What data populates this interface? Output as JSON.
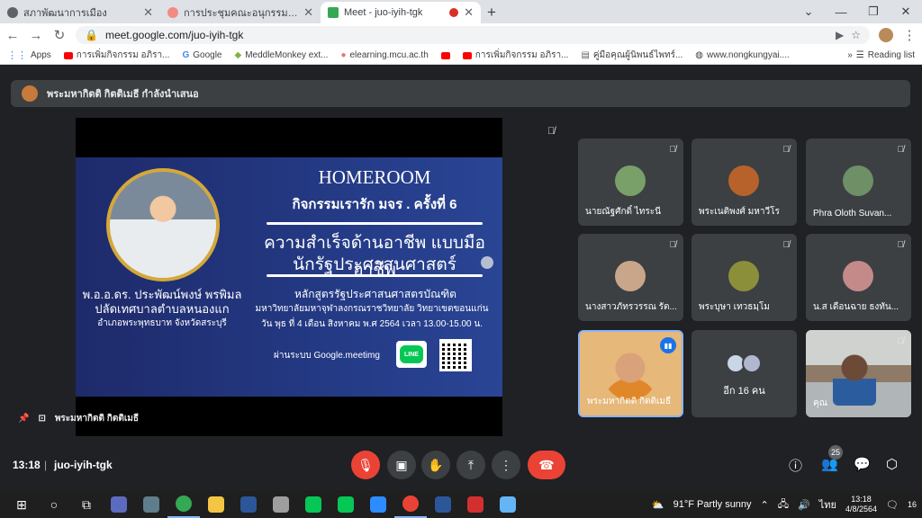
{
  "browser": {
    "tabs": [
      {
        "title": "สภาพัฒนาการเมือง",
        "fav_color": "#5f6368",
        "active": false
      },
      {
        "title": "การประชุมคณะอนุกรรมการสำเนินการประ",
        "fav_color": "#f28b82",
        "active": false
      },
      {
        "title": "Meet - juo-iyih-tgk",
        "fav_color": "#34a853",
        "active": true
      }
    ],
    "new_tab": "+",
    "url": "meet.google.com/juo-iyih-tgk",
    "bookmarks": [
      "Apps",
      "การเพิ่มกิจกรรม อภิรา...",
      "Google",
      "MeddleMonkey ext...",
      "elearning.mcu.ac.th",
      "การเพิ่มกิจกรรม อภิรา...",
      "คู่มือคุณผู้นิพนธ์ไพทร์...",
      "www.nongkungyai...."
    ],
    "reading_list": "Reading list"
  },
  "meet": {
    "presenter_banner": "พระมหากิตติ กิตติเมธี กำลังนำเสนอ",
    "stage_label": "พระมหากิตติ กิตติเมธี",
    "slide": {
      "homeroom": "HOMEROOM",
      "activity": "กิจกรรมเรารัก มจร . ครั้งที่ 6",
      "title1": "ความสำเร็จด้านอาชีพ แบบมืออาชีพ",
      "title2": "นักรัฐประศาสนศาสตร์",
      "speaker_name": "พ.อ.อ.ดร. ประพัฒน์พงษ์ พรพิมล",
      "speaker_post": "ปลัดเทศบาลตำบลหนองแก",
      "speaker_district": "อำเภอพระพุทธบาท จังหวัดสระบุรี",
      "course": "หลักสูตรรัฐประศาสนศาสตรบัณฑิต",
      "university": "มหาวิทยาลัยมหาจุฬาลงกรณราชวิทยาลัย วิทยาเขตขอนแก่น",
      "date": "วัน พุธ ที่ 4 เดือน สิงหาคม พ.ศ 2564  เวลา 13.00-15.00 น.",
      "via": "ผ่านระบบ  Google.meetimg",
      "line": "LINE"
    },
    "participants": [
      {
        "name": "นายณัฐศักดิ์ ไทระนี",
        "color": "#7aa06a"
      },
      {
        "name": "พระเนติพงศ์ มหาวีโร",
        "color": "#b7622a"
      },
      {
        "name": "Phra Oloth Suvan...",
        "color": "#6f8f66"
      },
      {
        "name": "นางสาวภัทรวรรณ รัต...",
        "color": "#c9a68a"
      },
      {
        "name": "พระบุษา เทวธมฺโม",
        "color": "#8b8f3a"
      },
      {
        "name": "น.ส เดือนฉาย ธงทัน...",
        "color": "#c48a8a"
      }
    ],
    "speaker_tile": "พระมหากิตติ กิตติเมธี",
    "more_people": "อีก 16 คน",
    "cam_tile": "คุณ",
    "controls": {
      "time": "13:18",
      "code": "juo-iyih-tgk",
      "people_count": "25"
    }
  },
  "taskbar": {
    "weather": "91°F  Partly sunny",
    "time": "13:18",
    "date": "4/8/2564",
    "lang": "ไทย",
    "notif": "16"
  }
}
